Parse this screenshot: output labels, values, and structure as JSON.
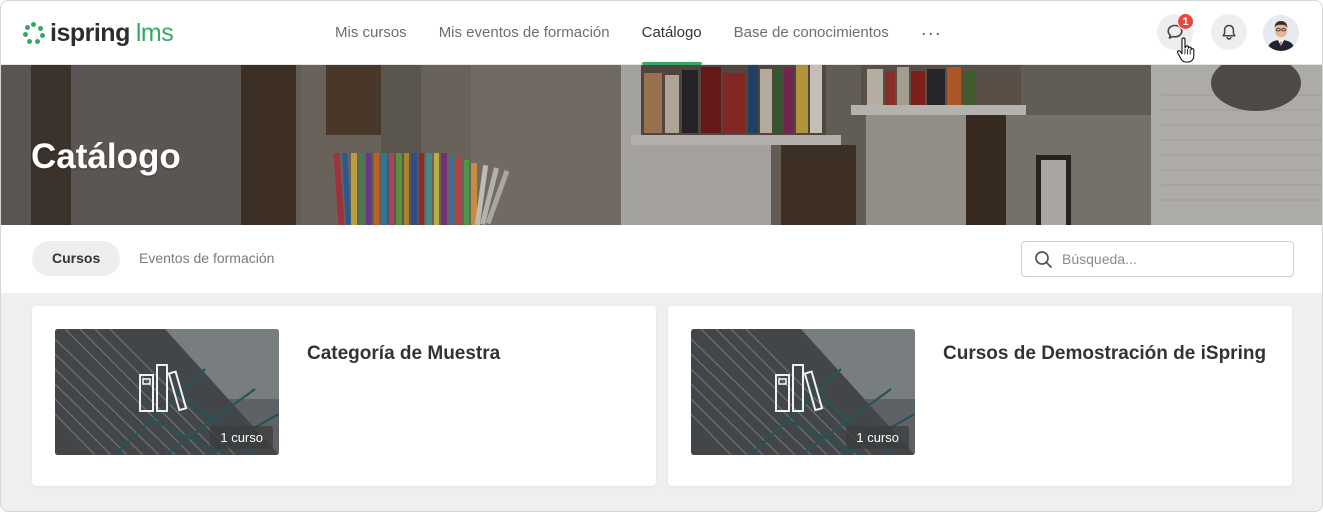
{
  "brand": {
    "name": "ispring",
    "product": "lms",
    "accent": "#37a864"
  },
  "nav": {
    "items": [
      {
        "label": "Mis cursos",
        "active": false
      },
      {
        "label": "Mis eventos de formación",
        "active": false
      },
      {
        "label": "Catálogo",
        "active": true
      },
      {
        "label": "Base de conocimientos",
        "active": false
      }
    ],
    "more_label": "···"
  },
  "header": {
    "chat_icon": "chat-bubble-icon",
    "chat_badge": "1",
    "notifications_icon": "bell-icon",
    "avatar": "user-avatar"
  },
  "hero": {
    "title": "Catálogo"
  },
  "tabs": [
    {
      "label": "Cursos",
      "active": true
    },
    {
      "label": "Eventos de formación",
      "active": false
    }
  ],
  "search": {
    "placeholder": "Búsqueda...",
    "value": ""
  },
  "cards": [
    {
      "title": "Categoría de Muestra",
      "count": "1 curso",
      "icon": "books-icon"
    },
    {
      "title": "Cursos de Demostración de iSpring",
      "count": "1 curso",
      "icon": "books-icon"
    }
  ],
  "colors": {
    "badge": "#e8473f",
    "page_bg": "#efefef"
  }
}
